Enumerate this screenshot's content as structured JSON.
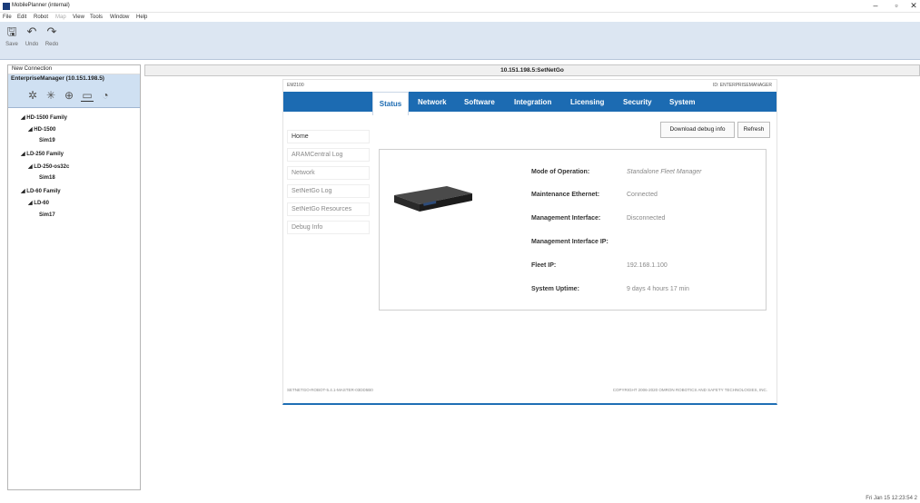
{
  "window": {
    "title": "MobilePlanner (internal)",
    "minimize": "–",
    "restore": "▫",
    "close": "✕"
  },
  "menu": [
    "File",
    "Edit",
    "Robot",
    "Map",
    "View",
    "Tools",
    "Window",
    "Help"
  ],
  "toolbar": [
    {
      "label": "Save",
      "icon": "save-icon",
      "glyph": "🖫"
    },
    {
      "label": "Undo",
      "icon": "undo-icon",
      "glyph": "↶"
    },
    {
      "label": "Redo",
      "icon": "redo-icon",
      "glyph": "↷"
    }
  ],
  "nav": {
    "new_connection": "New Connection",
    "em_title": "EnterpriseManager (10.151.198.5)",
    "em_icons": [
      {
        "name": "traffic-icon",
        "glyph": "✲"
      },
      {
        "name": "config-icon",
        "glyph": "✳"
      },
      {
        "name": "network-icon",
        "glyph": "⊕"
      },
      {
        "name": "monitor-icon",
        "glyph": "▭"
      },
      {
        "name": "pie-icon",
        "glyph": "◔"
      }
    ],
    "tree": [
      {
        "label": "◢ HD-1500 Family",
        "indent": 0
      },
      {
        "label": "◢ HD-1500",
        "indent": 1
      },
      {
        "label": "Sim19",
        "indent": 2
      },
      {
        "label": "◢ LD-250 Family",
        "indent": 0
      },
      {
        "label": "◢ LD-250-os32c",
        "indent": 1
      },
      {
        "label": "Sim18",
        "indent": 2
      },
      {
        "label": "◢ LD-60 Family",
        "indent": 0
      },
      {
        "label": "◢ LD-60",
        "indent": 1
      },
      {
        "label": "Sim17",
        "indent": 2
      }
    ]
  },
  "tab": {
    "title": "10.151.198.5:SetNetGo"
  },
  "web": {
    "model": "EM2100",
    "device_id": "ID: ENTERPRISEMANAGER",
    "tabs": [
      "Status",
      "Network",
      "Software",
      "Integration",
      "Licensing",
      "Security",
      "System"
    ],
    "actions": [
      "Download debug info",
      "Refresh"
    ],
    "sidebar": [
      "Home",
      "ARAMCentral Log",
      "Network",
      "SetNetGo Log",
      "SetNetGo Resources",
      "Debug Info"
    ],
    "status": [
      {
        "label": "Mode of Operation:",
        "value": "Standalone Fleet Manager"
      },
      {
        "label": "Maintenance Ethernet:",
        "value": "Connected"
      },
      {
        "label": "Management Interface:",
        "value": "Disconnected"
      },
      {
        "label": "Management Interface IP:",
        "value": ""
      },
      {
        "label": "Fleet IP:",
        "value": "192.168.1.100"
      },
      {
        "label": "System Uptime:",
        "value": "9 days 4 hours 17 min"
      }
    ],
    "footer_left": "SETNETGO-ROBOT-5.4.1-MASTER-03DD5B0",
    "footer_right": "COPYRIGHT 2006-2020 OMRON ROBOTICS AND SAFETY TECHNOLOGIES, INC."
  },
  "statusbar": {
    "datetime": "Fri Jan 15 12:23:54 2"
  },
  "colors": {
    "accent": "#1c6bb2",
    "selection": "#cfe0f2"
  }
}
